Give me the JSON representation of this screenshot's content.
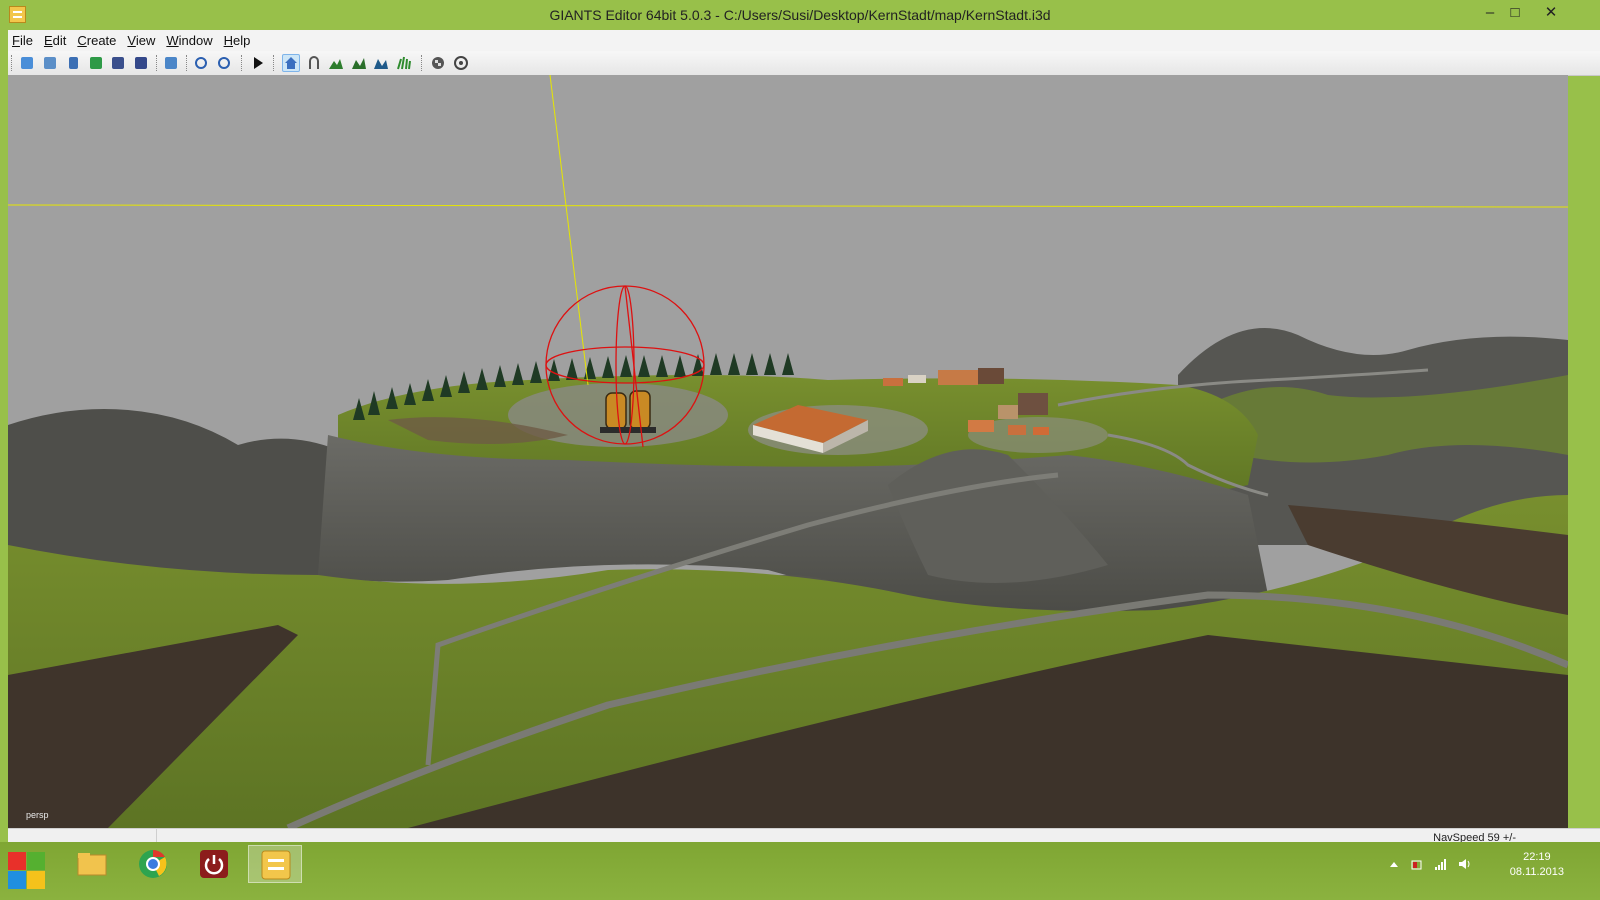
{
  "window": {
    "title": "GIANTS Editor 64bit 5.0.3 - C:/Users/Susi/Desktop/KernStadt/map/KernStadt.i3d",
    "controls": {
      "minimize": "–",
      "maximize": "□",
      "close": "✕"
    }
  },
  "menu": {
    "items": [
      "File",
      "Edit",
      "Create",
      "View",
      "Window",
      "Help"
    ]
  },
  "toolbar": {
    "icons": [
      "new-scene-icon",
      "open-icon",
      "list-icon",
      "refresh-icon",
      "save-icon",
      "save-all-icon",
      "import-icon",
      "undo-icon",
      "redo-icon",
      "play-icon",
      "home-select-icon",
      "magnet-icon",
      "terrain-sculpt-icon",
      "terrain-paint-icon",
      "foliage-paint-icon",
      "grass-paint-icon",
      "checker-icon",
      "settings-icon"
    ]
  },
  "viewport": {
    "camera_label": "persp",
    "sky_color": "#a0a0a0",
    "grass_color": "#6f8a2c"
  },
  "status": {
    "navspeed": "NavSpeed 59 +/-"
  },
  "taskbar": {
    "apps": [
      "file-explorer",
      "chrome",
      "power-app",
      "giants-editor"
    ],
    "active_app": "giants-editor",
    "clock_time": "22:19",
    "clock_date": "08.11.2013"
  },
  "colors": {
    "frame": "#98c04a",
    "taskbar": "#85ac38",
    "gizmo": "#dd1111",
    "axis": "#e6e600"
  }
}
